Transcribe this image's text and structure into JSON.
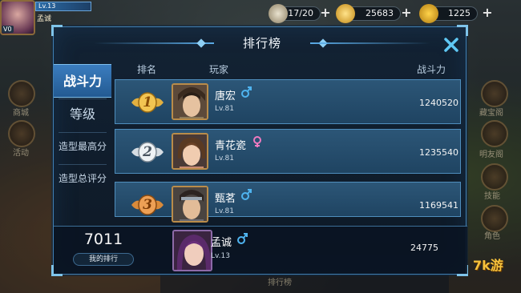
{
  "hud": {
    "player_level": "Lv.13",
    "player_name": "孟诚",
    "vip": "V0",
    "stamina": "17/20",
    "silver": "25683",
    "gold": "1225"
  },
  "side_buttons_left": [
    "商城",
    "活动"
  ],
  "side_buttons_right": [
    "藏宝阁",
    "明友阁",
    "技能",
    "角色"
  ],
  "bottom_bar": [
    "排行榜"
  ],
  "panel": {
    "title": "排行榜",
    "tabs": [
      {
        "label": "战斗力",
        "active": true
      },
      {
        "label": "等级",
        "active": false
      },
      {
        "label": "造型最高分",
        "active": false
      },
      {
        "label": "造型总评分",
        "active": false
      }
    ],
    "columns": {
      "rank": "排名",
      "player": "玩家",
      "power": "战斗力"
    },
    "rows": [
      {
        "rank": "1",
        "name": "唐宏",
        "gender": "male",
        "level": "Lv.81",
        "power": "1240520"
      },
      {
        "rank": "2",
        "name": "青花瓷",
        "gender": "female",
        "level": "Lv.81",
        "power": "1235540"
      },
      {
        "rank": "3",
        "name": "甄茗",
        "gender": "male",
        "level": "Lv.81",
        "power": "1169541"
      }
    ],
    "my": {
      "rank": "7011",
      "rank_label": "我的排行",
      "name": "孟诚",
      "gender": "male",
      "level": "Lv.13",
      "power": "24775"
    }
  },
  "colors": {
    "male": "#4fb4f0",
    "female": "#f07ac0",
    "gold_medal": "#e2b040",
    "silver_medal": "#d6dde3",
    "bronze_medal": "#d98a3a"
  },
  "watermark": "7k游"
}
